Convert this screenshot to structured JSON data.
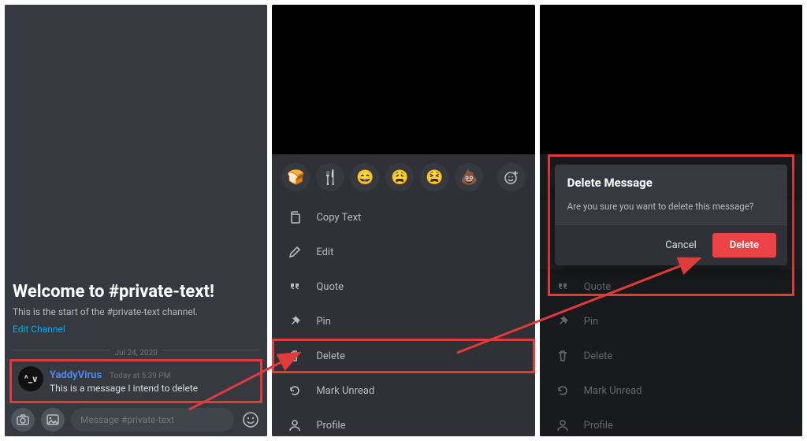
{
  "colors": {
    "highlight": "#e03b3b",
    "danger": "#ed4245",
    "link": "#00aff4",
    "author": "#4e8cff"
  },
  "panel1": {
    "welcome_title": "Welcome to #private-text!",
    "welcome_sub": "This is the start of the #private-text channel.",
    "edit_channel": "Edit Channel",
    "date_divider": "Jul 24, 2020",
    "message": {
      "avatar_glyph": "^_v",
      "author": "YaddyVirus",
      "timestamp": "Today at 5:39 PM",
      "text": "This is a message I intend to delete"
    },
    "input_placeholder": "Message #private-text"
  },
  "panel2": {
    "emoji_row": [
      "🍞",
      "🍴",
      "😄",
      "😩",
      "😫",
      "💩"
    ],
    "add_reaction_icon": "add-reaction-icon",
    "menu": [
      {
        "icon": "copy-icon",
        "label": "Copy Text",
        "highlight": false
      },
      {
        "icon": "pencil-icon",
        "label": "Edit",
        "highlight": false
      },
      {
        "icon": "quote-icon",
        "label": "Quote",
        "highlight": false
      },
      {
        "icon": "pin-icon",
        "label": "Pin",
        "highlight": false
      },
      {
        "icon": "trash-icon",
        "label": "Delete",
        "highlight": true
      },
      {
        "icon": "refresh-icon",
        "label": "Mark Unread",
        "highlight": false
      },
      {
        "icon": "person-icon",
        "label": "Profile",
        "highlight": false
      }
    ]
  },
  "panel3": {
    "emoji_peek": "🍞",
    "menu_visible": [
      {
        "icon": "quote-icon",
        "label": "Quote"
      },
      {
        "icon": "pin-icon",
        "label": "Pin"
      },
      {
        "icon": "trash-icon",
        "label": "Delete"
      },
      {
        "icon": "refresh-icon",
        "label": "Mark Unread"
      },
      {
        "icon": "person-icon",
        "label": "Profile"
      }
    ],
    "dialog": {
      "title": "Delete Message",
      "body": "Are you sure you want to delete this message?",
      "cancel": "Cancel",
      "confirm": "Delete"
    }
  }
}
